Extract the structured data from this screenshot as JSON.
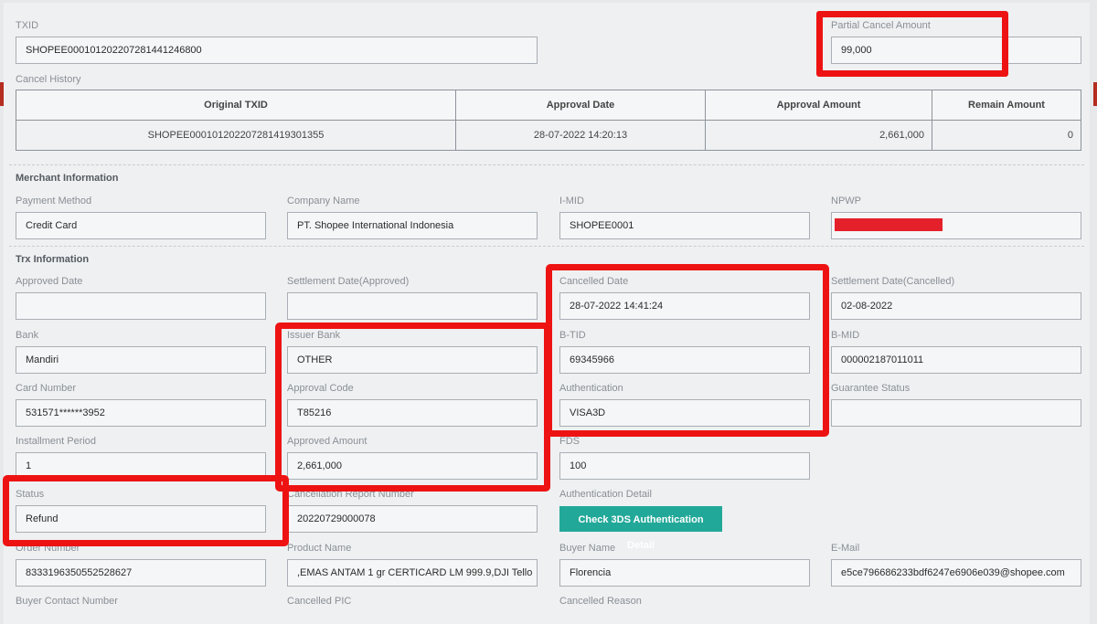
{
  "colors": {
    "link": "#2a6ea8",
    "button_bg": "#22a899",
    "highlight": "#ee1313",
    "redaction": "#e4202a"
  },
  "txid": {
    "label": "TXID",
    "value": "SHOPEE0001012022072814412468​00"
  },
  "partial_cancel": {
    "label": "Partial Cancel Amount",
    "value": "99,000"
  },
  "cancel_history": {
    "label": "Cancel History",
    "columns": [
      "Original TXID",
      "Approval Date",
      "Approval Amount",
      "Remain Amount"
    ],
    "rows": [
      [
        "SHOPEE000101202207281419301355",
        "28-07-2022 14:20:13",
        "2,661,000",
        "0"
      ]
    ]
  },
  "merchant": {
    "title": "Merchant Information",
    "payment_method": {
      "label": "Payment Method",
      "value": "Credit Card"
    },
    "company_name": {
      "label": "Company Name",
      "value": "PT. Shopee International Indonesia"
    },
    "imid": {
      "label": "I-MID",
      "value": "SHOPEE0001"
    },
    "npwp": {
      "label": "NPWP",
      "value": ""
    }
  },
  "trx": {
    "title": "Trx Information",
    "approved_date": {
      "label": "Approved Date",
      "value": ""
    },
    "settlement_approved": {
      "label": "Settlement Date(Approved)",
      "value": ""
    },
    "cancelled_date": {
      "label": "Cancelled Date",
      "value": "28-07-2022 14:41:24"
    },
    "settlement_cancelled": {
      "label": "Settlement Date(Cancelled)",
      "value": "02-08-2022"
    },
    "bank": {
      "label": "Bank",
      "value": "Mandiri"
    },
    "issuer_bank": {
      "label": "Issuer Bank",
      "value": "OTHER"
    },
    "btid": {
      "label": "B-TID",
      "value": "69345966"
    },
    "bmid": {
      "label": "B-MID",
      "value": "000002187011011"
    },
    "card_number": {
      "label": "Card Number",
      "value": "531571******3952"
    },
    "approval_code": {
      "label": "Approval Code",
      "value": "T85216"
    },
    "authentication": {
      "label": "Authentication",
      "value": "VISA3D"
    },
    "guarantee_status": {
      "label": "Guarantee Status",
      "value": ""
    },
    "installment": {
      "label": "Installment Period",
      "value": "1"
    },
    "approved_amount": {
      "label": "Approved Amount",
      "value": "2,661,000"
    },
    "fds": {
      "label": "FDS",
      "value": "100"
    },
    "status": {
      "label": "Status",
      "value": "Refund"
    },
    "cancel_report": {
      "label": "Cancellation Report Number",
      "value": "20220729000078"
    },
    "auth_detail": {
      "label": "Authentication Detail",
      "button": "Check 3DS Authentication Detail"
    },
    "order_number": {
      "label": "Order Number",
      "value": "83331963505525286​27"
    },
    "product_name": {
      "label": "Product Name",
      "value": ",EMAS ANTAM 1 gr CERTICARD LM 999.9,DJI Tello"
    },
    "buyer_name": {
      "label": "Buyer Name",
      "value": "Florencia"
    },
    "email": {
      "label": "E-Mail",
      "value": "e5ce796686233bdf6247e6906e039@shopee.com"
    },
    "buyer_contact": {
      "label": "Buyer Contact Number"
    },
    "cancelled_pic": {
      "label": "Cancelled PIC"
    },
    "cancelled_reason": {
      "label": "Cancelled Reason"
    }
  }
}
